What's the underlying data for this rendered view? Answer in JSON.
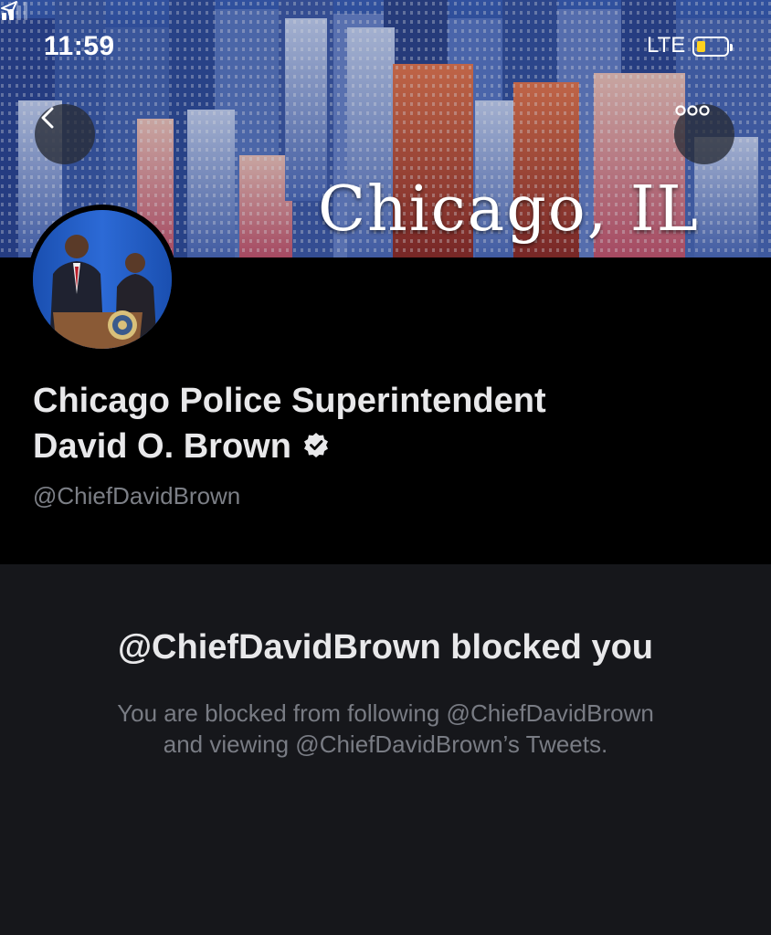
{
  "status_bar": {
    "time": "11:59",
    "network": "LTE",
    "battery_fraction": 0.3
  },
  "banner": {
    "text": "Chicago, IL"
  },
  "profile": {
    "name_line1": "Chicago Police Superintendent",
    "name_line2": "David O. Brown",
    "handle": "@ChiefDavidBrown",
    "verified": true
  },
  "blocked": {
    "title": "@ChiefDavidBrown blocked you",
    "desc_line1": "You are blocked from following @ChiefDavidBrown",
    "desc_line2": "and viewing @ChiefDavidBrown’s Tweets."
  },
  "icons": {
    "back": "chevron-left-icon",
    "more": "more-dots-icon",
    "verified": "verified-badge-icon",
    "location": "location-arrow-icon"
  },
  "colors": {
    "background": "#16171b",
    "header": "#000000",
    "battery": "#ffd21f"
  }
}
